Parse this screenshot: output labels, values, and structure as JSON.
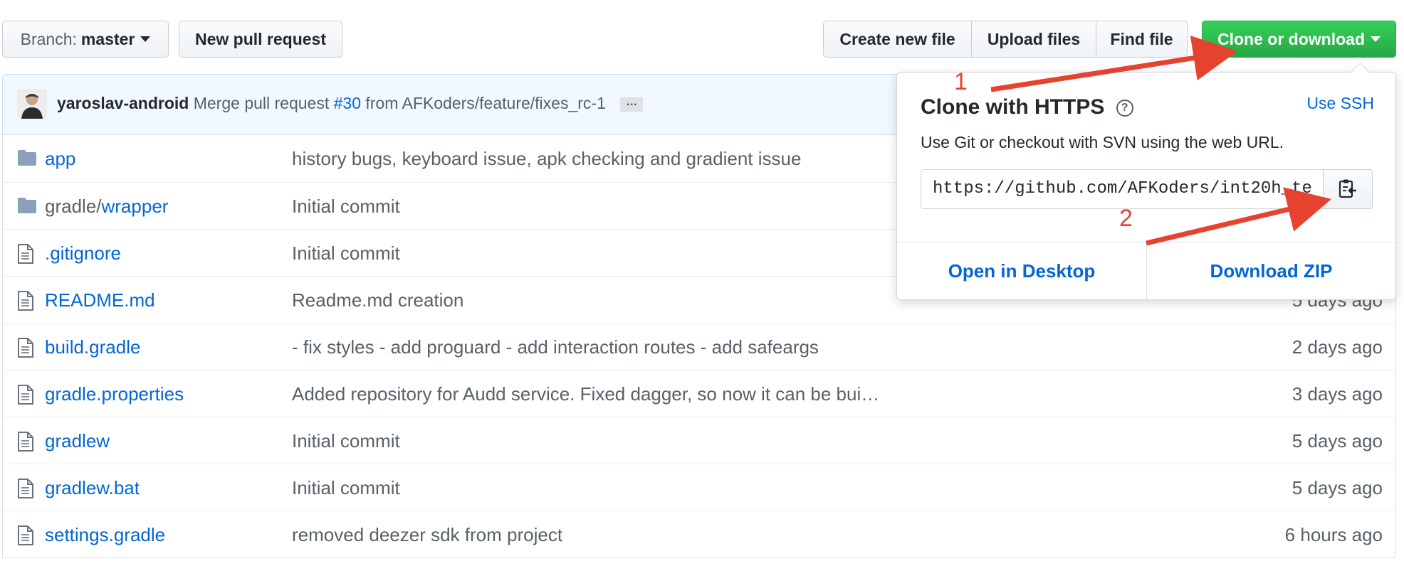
{
  "toolbar": {
    "branch_prefix": "Branch:",
    "branch_name": "master",
    "new_pull_request": "New pull request",
    "create_new_file": "Create new file",
    "upload_files": "Upload files",
    "find_file": "Find file",
    "clone_or_download": "Clone or download"
  },
  "commit": {
    "author": "yaroslav-android",
    "message_prefix": "Merge pull request",
    "pr_number": "#30",
    "message_suffix": "from AFKoders/feature/fixes_rc-1",
    "more": "…"
  },
  "files": [
    {
      "type": "folder",
      "name": "app",
      "dim_prefix": "",
      "message": "history bugs, keyboard issue, apk checking and gradient issue",
      "age": ""
    },
    {
      "type": "folder",
      "name": "wrapper",
      "dim_prefix": "gradle/",
      "message": "Initial commit",
      "age": ""
    },
    {
      "type": "file",
      "name": ".gitignore",
      "dim_prefix": "",
      "message": "Initial commit",
      "age": ""
    },
    {
      "type": "file",
      "name": "README.md",
      "dim_prefix": "",
      "message": "Readme.md creation",
      "age": "5 days ago"
    },
    {
      "type": "file",
      "name": "build.gradle",
      "dim_prefix": "",
      "message": "- fix styles - add proguard - add interaction routes - add safeargs",
      "age": "2 days ago"
    },
    {
      "type": "file",
      "name": "gradle.properties",
      "dim_prefix": "",
      "message": "Added repository for Audd service. Fixed dagger, so now it can be bui…",
      "age": "3 days ago"
    },
    {
      "type": "file",
      "name": "gradlew",
      "dim_prefix": "",
      "message": "Initial commit",
      "age": "5 days ago"
    },
    {
      "type": "file",
      "name": "gradlew.bat",
      "dim_prefix": "",
      "message": "Initial commit",
      "age": "5 days ago"
    },
    {
      "type": "file",
      "name": "settings.gradle",
      "dim_prefix": "",
      "message": "removed deezer sdk from project",
      "age": "6 hours ago"
    }
  ],
  "clone_dropdown": {
    "title": "Clone with HTTPS",
    "help_glyph": "?",
    "use_ssh": "Use SSH",
    "description": "Use Git or checkout with SVN using the web URL.",
    "url": "https://github.com/AFKoders/int20h_te",
    "open_in_desktop": "Open in Desktop",
    "download_zip": "Download ZIP"
  },
  "annotations": {
    "step1": "1",
    "step2": "2",
    "arrow_color": "#e5432f"
  },
  "colors": {
    "link": "#0366d6",
    "clone_button": "#28a745",
    "commit_bar_bg": "#f1f8ff"
  }
}
